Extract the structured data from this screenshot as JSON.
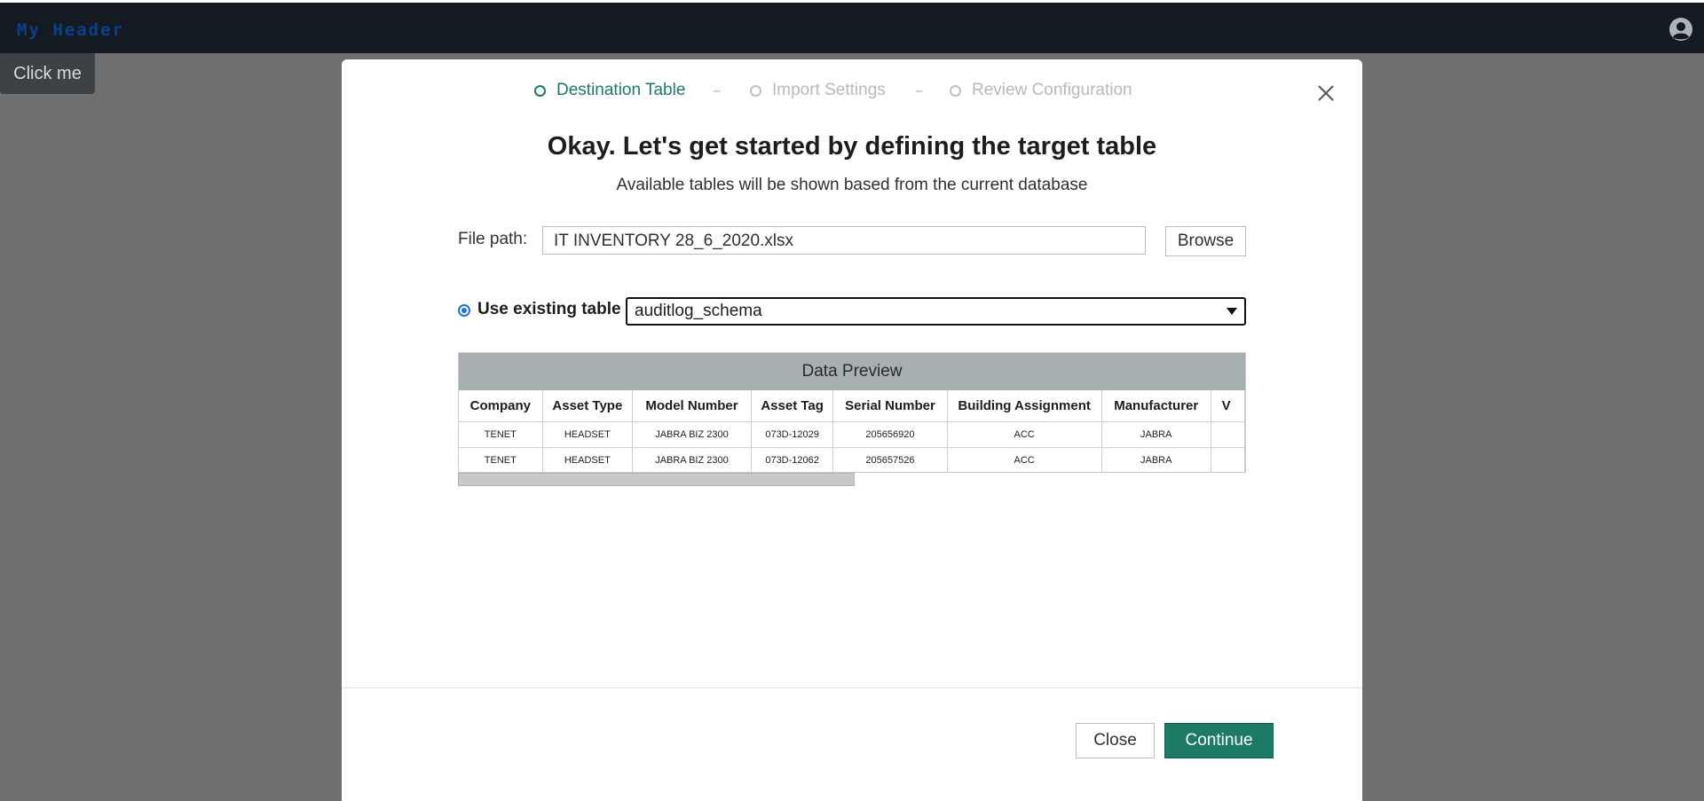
{
  "header": {
    "title": "My Header",
    "user_icon": "user-circle-icon"
  },
  "floating_button": {
    "label": "Click me"
  },
  "modal": {
    "steps": [
      {
        "label": "Destination Table",
        "state": "active"
      },
      {
        "label": "Import Settings",
        "state": "inactive"
      },
      {
        "label": "Review Configuration",
        "state": "inactive"
      }
    ],
    "step_separator": "–",
    "close_icon": "close-icon",
    "heading": "Okay. Let's get started by defining the target table",
    "subheading": "Available tables will be shown based from the current database",
    "file_path": {
      "label": "File path:",
      "value": "IT INVENTORY 28_6_2020.xlsx"
    },
    "browse_label": "Browse",
    "existing_table": {
      "label": "Use existing table",
      "selected": "auditlog_schema"
    },
    "preview": {
      "title": "Data Preview",
      "columns": [
        "Company",
        "Asset Type",
        "Model Number",
        "Asset Tag",
        "Serial Number",
        "Building Assignment",
        "Manufacturer",
        "V"
      ],
      "rows": [
        [
          "TENET",
          "HEADSET",
          "JABRA BIZ 2300",
          "073D-12029",
          "205656920",
          "ACC",
          "JABRA",
          ""
        ],
        [
          "TENET",
          "HEADSET",
          "JABRA BIZ 2300",
          "073D-12062",
          "205657526",
          "ACC",
          "JABRA",
          ""
        ]
      ]
    },
    "footer": {
      "close_label": "Close",
      "continue_label": "Continue"
    }
  },
  "colors": {
    "accent": "#1d7a64",
    "header_bg": "#141a22",
    "overlay": "#6f6f6f"
  }
}
